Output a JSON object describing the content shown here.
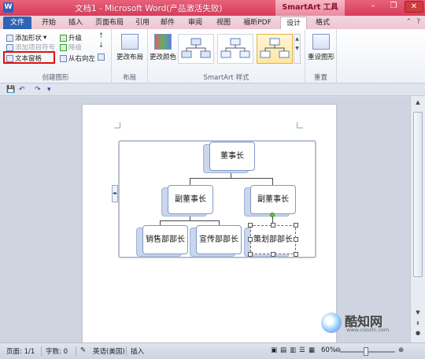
{
  "window": {
    "title": "文档1 - Microsoft Word(产品激活失败)",
    "contextual_tab_group": "SmartArt 工具",
    "app_icon": "W"
  },
  "tabs": [
    "文件",
    "开始",
    "插入",
    "页面布局",
    "引用",
    "邮件",
    "审阅",
    "视图",
    "福昕PDF",
    "设计",
    "格式"
  ],
  "active_tab": "设计",
  "ribbon": {
    "create_graphic": {
      "label": "创建图形",
      "add_shape": "添加形状",
      "add_bullet": "添加项目符号",
      "text_pane": "文本窗格",
      "promote": "升级",
      "demote": "降级",
      "right_to_left": "从右向左"
    },
    "layout": {
      "label": "布局",
      "change_layout": "更改布局"
    },
    "smartart_styles": {
      "label": "SmartArt 样式",
      "change_colors": "更改颜色"
    },
    "reset": {
      "label": "重置",
      "reset_graphic": "重设图形"
    }
  },
  "org_chart": {
    "root": "董事长",
    "level2": [
      "副董事长",
      "副董事长"
    ],
    "level3": [
      "销售部部长",
      "宣传部部长",
      "策划部部长"
    ]
  },
  "status": {
    "page": "页面: 1/1",
    "words": "字数: 0",
    "language": "英语(美国)",
    "mode": "插入",
    "zoom": "60%"
  },
  "watermark": {
    "brand": "酷知网",
    "url": "www.coozhi.com"
  },
  "colors": {
    "title_bar": "#d63c5a",
    "file_tab": "#2e63b5",
    "highlight_box": "#e01010",
    "node_border": "#7f9ac9"
  }
}
